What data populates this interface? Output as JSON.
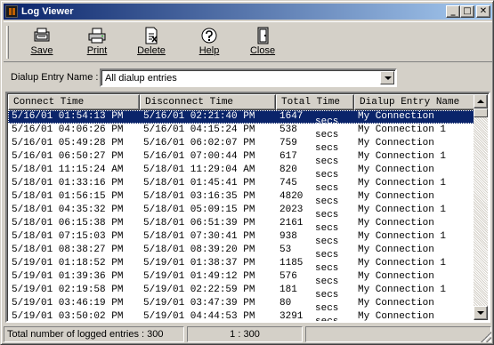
{
  "window": {
    "title": "Log Viewer",
    "controls": {
      "minimize": "_",
      "maximize": "□",
      "close": "✕"
    }
  },
  "toolbar": {
    "buttons": [
      {
        "label": "Save",
        "mnemonic": "S",
        "icon": "save-icon"
      },
      {
        "label": "Print",
        "mnemonic": "P",
        "icon": "printer-icon"
      },
      {
        "label": "Delete",
        "mnemonic": "D",
        "icon": "delete-icon"
      },
      {
        "label": "Help",
        "mnemonic": "H",
        "icon": "help-icon"
      },
      {
        "label": "Close",
        "mnemonic": "C",
        "icon": "close-door-icon"
      }
    ]
  },
  "filter": {
    "label": "Dialup Entry Name :",
    "selected": "All dialup entries"
  },
  "list": {
    "columns": [
      "Connect Time",
      "Disconnect Time",
      "Total Time",
      "Dialup Entry Name"
    ],
    "rows": [
      [
        "5/16/01 01:54:13 PM",
        "5/16/01 02:21:40 PM",
        "1647",
        "secs",
        "My Connection"
      ],
      [
        "5/16/01 04:06:26 PM",
        "5/16/01 04:15:24 PM",
        "538",
        "secs",
        "My Connection 1"
      ],
      [
        "5/16/01 05:49:28 PM",
        "5/16/01 06:02:07 PM",
        "759",
        "secs",
        "My Connection"
      ],
      [
        "5/16/01 06:50:27 PM",
        "5/16/01 07:00:44 PM",
        "617",
        "secs",
        "My Connection 1"
      ],
      [
        "5/18/01 11:15:24 AM",
        "5/18/01 11:29:04 AM",
        "820",
        "secs",
        "My Connection"
      ],
      [
        "5/18/01 01:33:16 PM",
        "5/18/01 01:45:41 PM",
        "745",
        "secs",
        "My Connection 1"
      ],
      [
        "5/18/01 01:56:15 PM",
        "5/18/01 03:16:35 PM",
        "4820",
        "secs",
        "My Connection"
      ],
      [
        "5/18/01 04:35:32 PM",
        "5/18/01 05:09:15 PM",
        "2023",
        "secs",
        "My Connection 1"
      ],
      [
        "5/18/01 06:15:38 PM",
        "5/18/01 06:51:39 PM",
        "2161",
        "secs",
        "My Connection"
      ],
      [
        "5/18/01 07:15:03 PM",
        "5/18/01 07:30:41 PM",
        "938",
        "secs",
        "My Connection 1"
      ],
      [
        "5/18/01 08:38:27 PM",
        "5/18/01 08:39:20 PM",
        "53",
        "secs",
        "My Connection"
      ],
      [
        "5/19/01 01:18:52 PM",
        "5/19/01 01:38:37 PM",
        "1185",
        "secs",
        "My Connection 1"
      ],
      [
        "5/19/01 01:39:36 PM",
        "5/19/01 01:49:12 PM",
        "576",
        "secs",
        "My Connection"
      ],
      [
        "5/19/01 02:19:58 PM",
        "5/19/01 02:22:59 PM",
        "181",
        "secs",
        "My Connection 1"
      ],
      [
        "5/19/01 03:46:19 PM",
        "5/19/01 03:47:39 PM",
        "80",
        "secs",
        "My Connection"
      ],
      [
        "5/19/01 03:50:02 PM",
        "5/19/01 04:44:53 PM",
        "3291",
        "secs",
        "My Connection"
      ]
    ],
    "selected_row": 0
  },
  "status": {
    "total": "Total number of logged entries : 300",
    "position": "1 : 300"
  }
}
